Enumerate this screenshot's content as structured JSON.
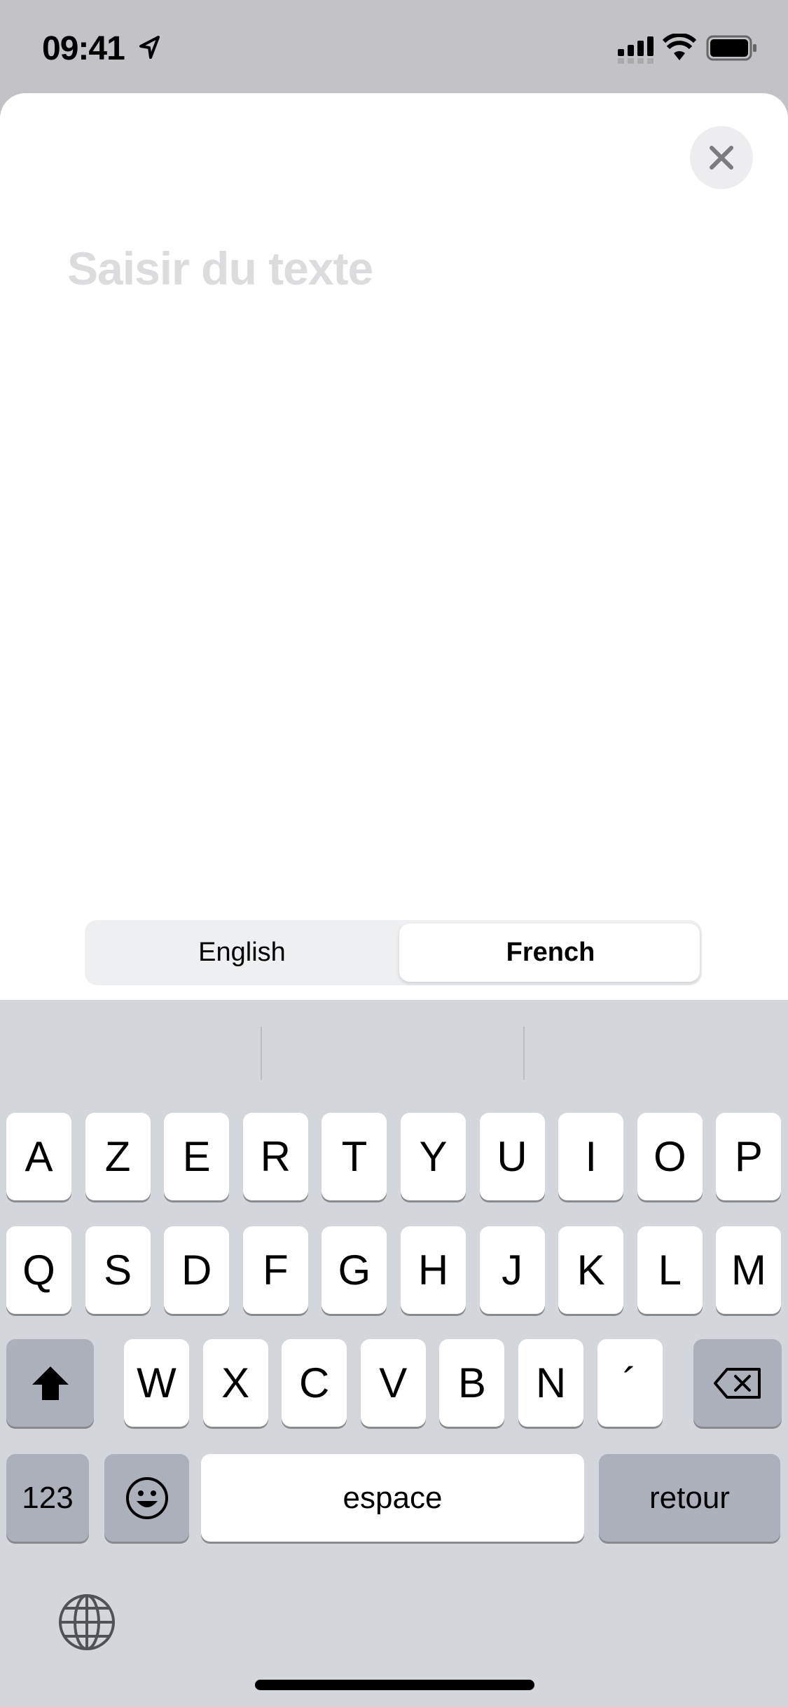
{
  "status_bar": {
    "time": "09:41",
    "icons": [
      "location-arrow-icon",
      "signal-icon",
      "wifi-icon",
      "battery-icon"
    ]
  },
  "sheet": {
    "close_icon": "close-icon",
    "placeholder": "Saisir du texte"
  },
  "language_selector": {
    "options": [
      "English",
      "French"
    ],
    "selected": "French"
  },
  "keyboard": {
    "row1": [
      "A",
      "Z",
      "E",
      "R",
      "T",
      "Y",
      "U",
      "I",
      "O",
      "P"
    ],
    "row2": [
      "Q",
      "S",
      "D",
      "F",
      "G",
      "H",
      "J",
      "K",
      "L",
      "M"
    ],
    "row3": [
      "W",
      "X",
      "C",
      "V",
      "B",
      "N",
      "´"
    ],
    "numbers_label": "123",
    "space_label": "espace",
    "return_label": "retour",
    "icons": [
      "shift-icon",
      "delete-icon",
      "emoji-icon",
      "globe-icon"
    ]
  }
}
